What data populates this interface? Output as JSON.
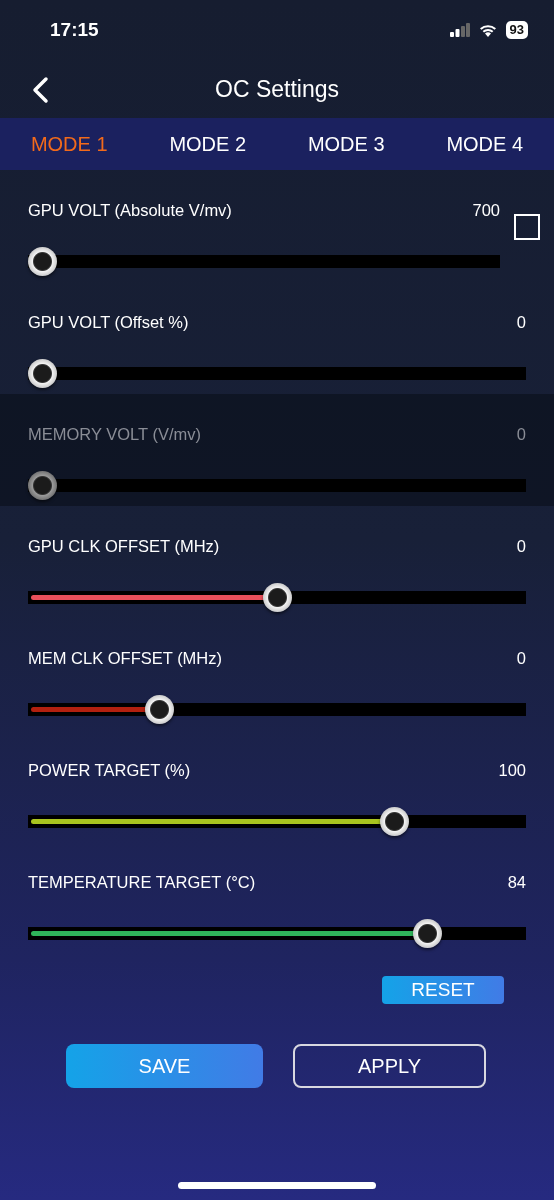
{
  "status_bar": {
    "time": "17:15",
    "battery": "93"
  },
  "header": {
    "title": "OC Settings"
  },
  "tabs": [
    {
      "label": "MODE 1",
      "selected": true
    },
    {
      "label": "MODE 2",
      "selected": false
    },
    {
      "label": "MODE 3",
      "selected": false
    },
    {
      "label": "MODE 4",
      "selected": false
    }
  ],
  "settings": [
    {
      "kind": "checkbox-slider",
      "label": "GPU VOLT (Absolute V/mv)",
      "value": "700",
      "level": 0,
      "checked": false,
      "disabled": false
    },
    {
      "kind": "slider",
      "label": "GPU VOLT (Offset %)",
      "value": "0",
      "level": 0,
      "disabled": false
    },
    {
      "kind": "slider",
      "label": "MEMORY VOLT (V/mv)",
      "value": "0",
      "level": 0,
      "disabled": true
    },
    {
      "kind": "slider",
      "label": "GPU CLK OFFSET (MHz)",
      "value": "0",
      "level": 0.5,
      "color": "#e8505b",
      "disabled": false
    },
    {
      "kind": "slider",
      "label": "MEM CLK OFFSET (MHz)",
      "value": "0",
      "level": 0.25,
      "color": "#b3200f",
      "disabled": false
    },
    {
      "kind": "slider",
      "label": "POWER TARGET (%)",
      "value": "100",
      "level": 0.75,
      "color": "#a9c41f",
      "disabled": false
    },
    {
      "kind": "slider",
      "label": "TEMPERATURE TARGET (°C)",
      "value": "84",
      "level": 0.82,
      "color": "#2fb55a",
      "disabled": false
    }
  ],
  "reset_button": "RESET",
  "buttons": [
    {
      "label": "SAVE",
      "kind": "primary"
    },
    {
      "label": "APPLY",
      "kind": "outline"
    }
  ]
}
